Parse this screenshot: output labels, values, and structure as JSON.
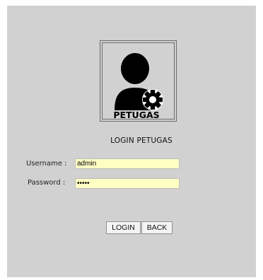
{
  "logo": {
    "text": "PETUGAS",
    "icon": "user-gear-icon"
  },
  "title": "LOGIN PETUGAS",
  "form": {
    "username_label": "Username :",
    "username_value": "admin",
    "password_label": "Password :",
    "password_value": "admin"
  },
  "buttons": {
    "login": "LOGIN",
    "back": "BACK"
  },
  "colors": {
    "panel": "#d1d1d1",
    "field_background": "#ffffc4"
  }
}
